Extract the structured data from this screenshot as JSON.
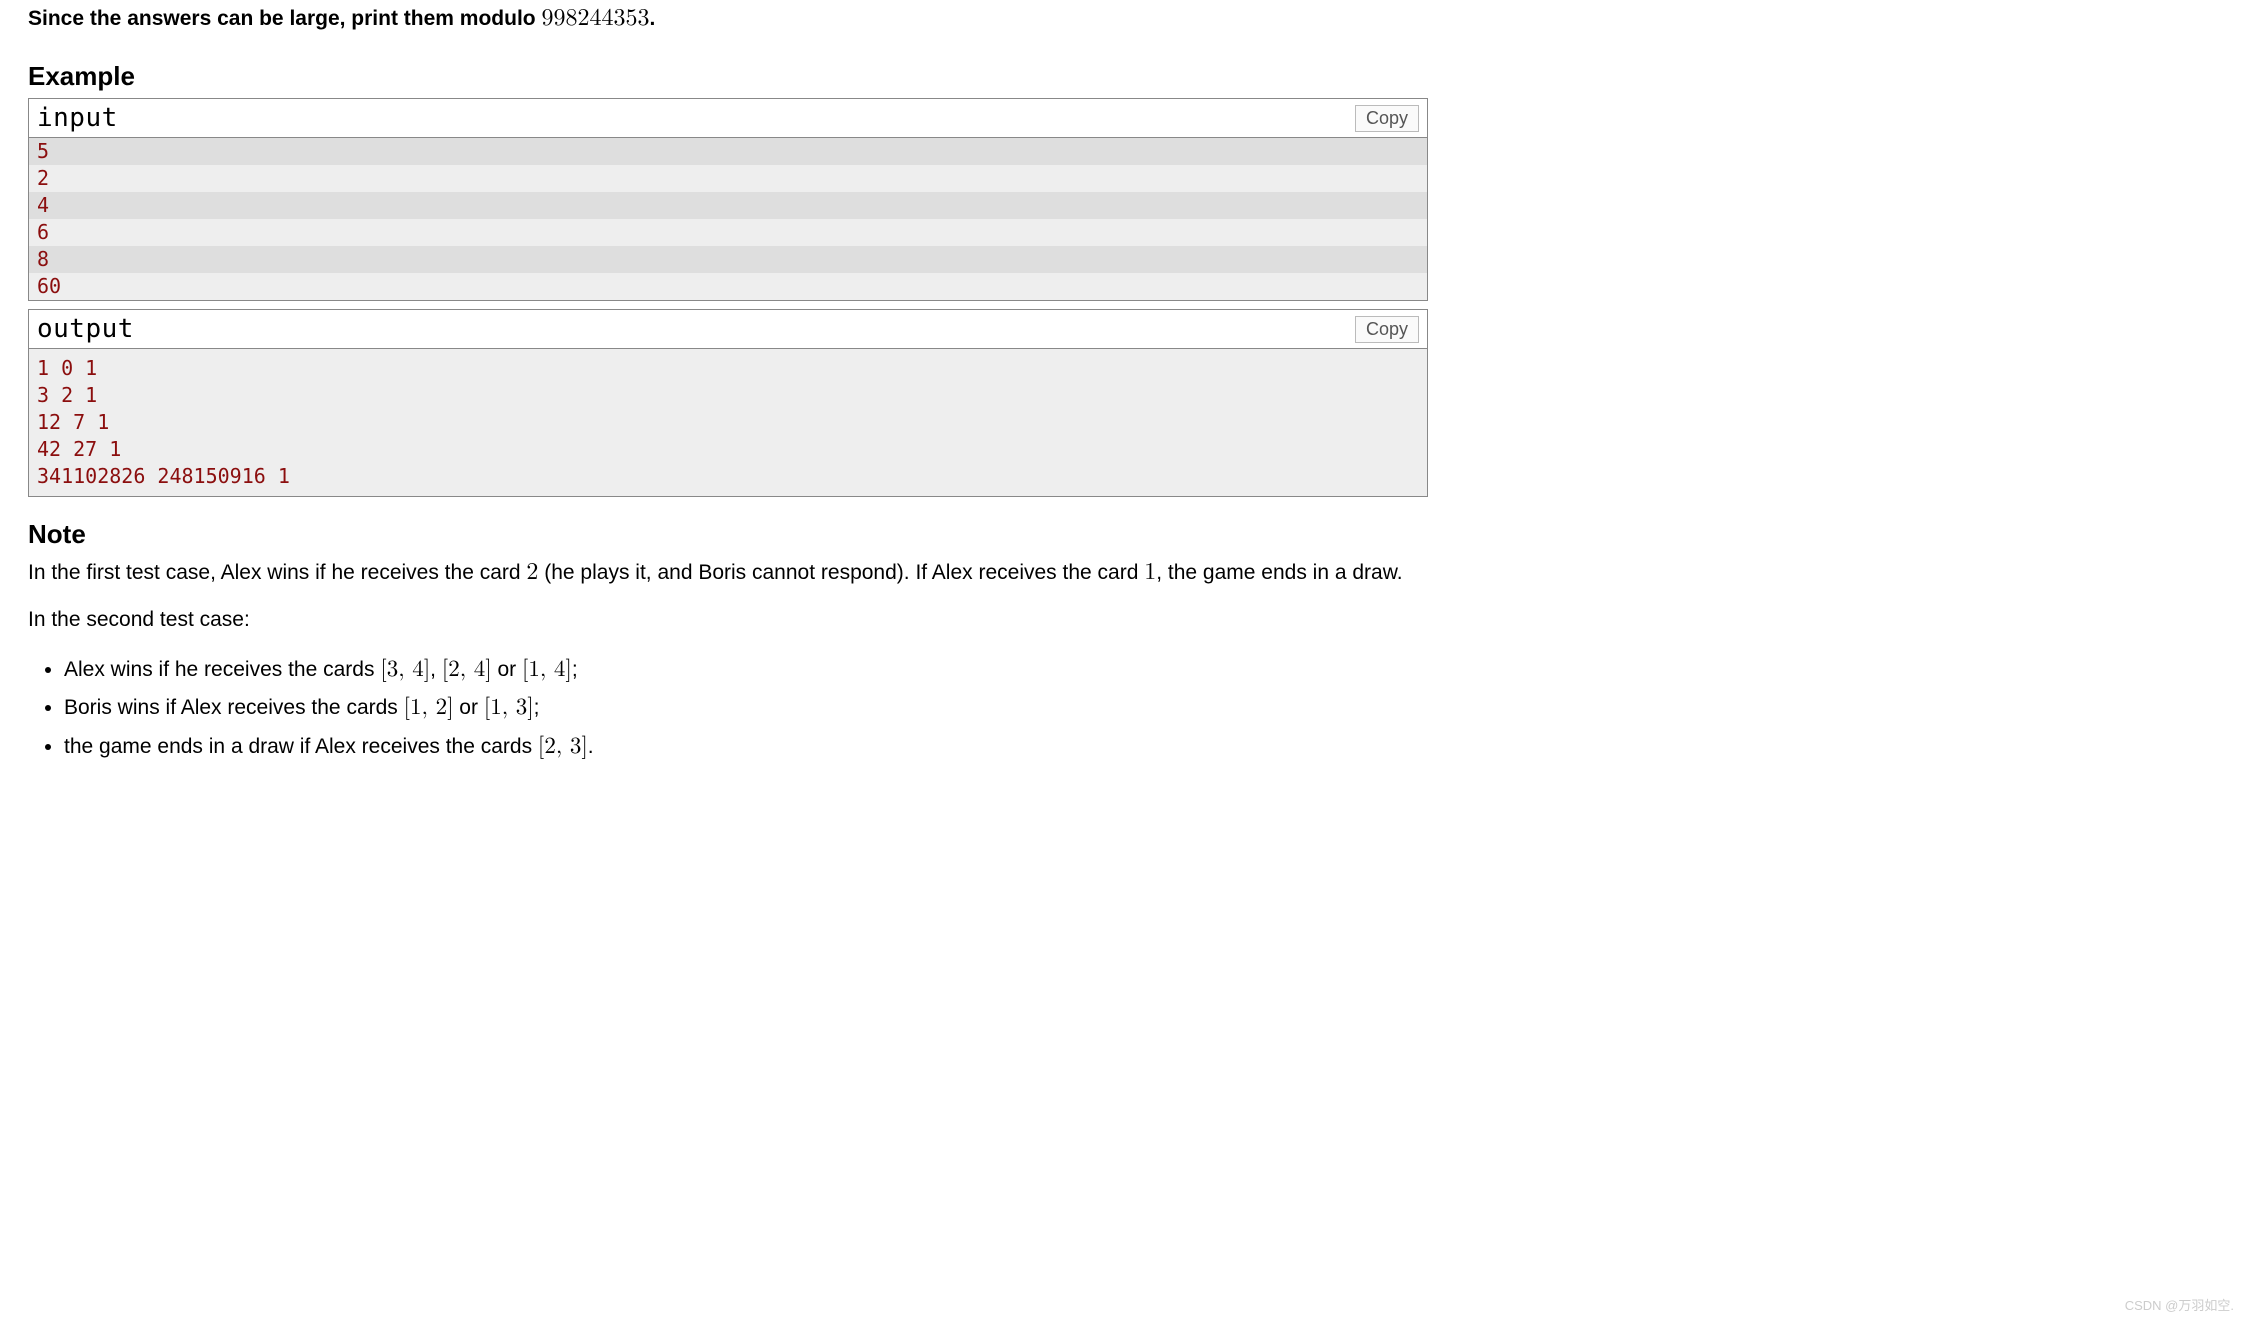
{
  "intro": {
    "prefix_bold": "Since the answers can be large, print them modulo ",
    "modulo": "998244353",
    "suffix": "."
  },
  "example_heading": "Example",
  "input_label": "input",
  "output_label": "output",
  "copy_label": "Copy",
  "input_lines": [
    "5",
    "2",
    "4",
    "6",
    "8",
    "60"
  ],
  "output_text": "1 0 1\n3 2 1\n12 7 1\n42 27 1\n341102826 248150916 1",
  "note_heading": "Note",
  "note_p1_a": "In the first test case, Alex wins if he receives the card ",
  "note_p1_card1": "2",
  "note_p1_b": " (he plays it, and Boris cannot respond). If Alex receives the card ",
  "note_p1_card2": "1",
  "note_p1_c": ", the game ends in a draw.",
  "note_p2": "In the second test case:",
  "bullets": {
    "b1_a": "Alex wins if he receives the cards ",
    "b1_s1": "[3, 4]",
    "b1_comma": ", ",
    "b1_s2": "[2, 4]",
    "b1_or": " or ",
    "b1_s3": "[1, 4]",
    "b1_end": ";",
    "b2_a": "Boris wins if Alex receives the cards ",
    "b2_s1": "[1, 2]",
    "b2_or": " or ",
    "b2_s2": "[1, 3]",
    "b2_end": ";",
    "b3_a": "the game ends in a draw if Alex receives the cards ",
    "b3_s1": "[2, 3]",
    "b3_end": "."
  },
  "watermark": "CSDN @万羽如空."
}
